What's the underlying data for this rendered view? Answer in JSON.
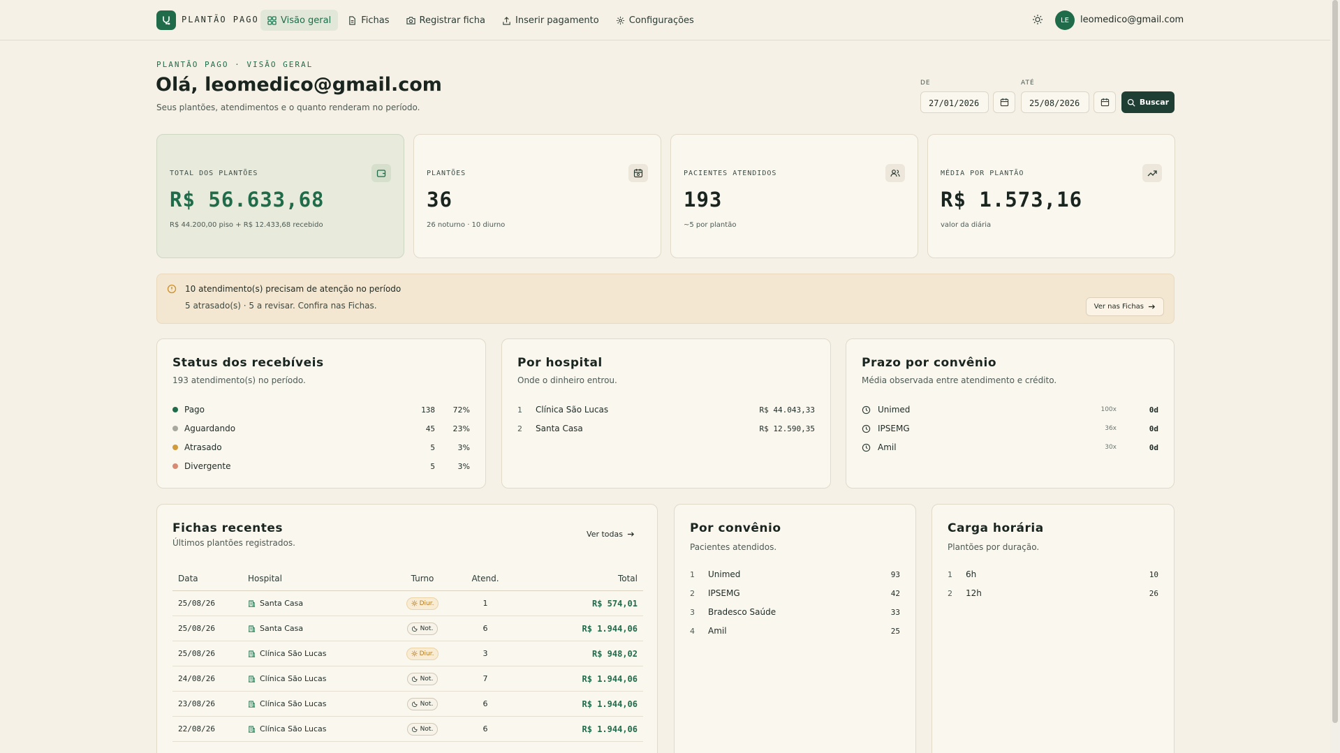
{
  "nav": {
    "brand": "PLANTÃO PAGO",
    "items": [
      {
        "label": "Visão geral",
        "icon": "grid-icon",
        "active": true
      },
      {
        "label": "Fichas",
        "icon": "file-icon"
      },
      {
        "label": "Registrar ficha",
        "icon": "camera-icon"
      },
      {
        "label": "Inserir pagamento",
        "icon": "upload-icon"
      },
      {
        "label": "Configurações",
        "icon": "gear-icon"
      }
    ],
    "avatar": "LE",
    "email": "leomedico@gmail.com"
  },
  "header": {
    "breadcrumb": "PLANTÃO PAGO · VISÃO GERAL",
    "greeting": "Olá, leomedico@gmail.com",
    "subtitle": "Seus plantões, atendimentos e o quanto renderam no período.",
    "from_label": "DE",
    "from_value": "27/01/2026",
    "to_label": "ATÉ",
    "to_value": "25/08/2026",
    "search_label": "Buscar"
  },
  "stats": [
    {
      "label": "TOTAL DOS PLANTÕES",
      "value": "R$ 56.633,68",
      "note": "R$ 44.200,00 piso + R$ 12.433,68 recebido",
      "icon": "wallet-icon"
    },
    {
      "label": "PLANTÕES",
      "value": "36",
      "note": "26 noturno · 10 diurno",
      "icon": "calendar-icon"
    },
    {
      "label": "PACIENTES ATENDIDOS",
      "value": "193",
      "note": "~5 por plantão",
      "icon": "users-icon"
    },
    {
      "label": "MÉDIA POR PLANTÃO",
      "value": "R$ 1.573,16",
      "note": "valor da diária",
      "icon": "trend-up-icon"
    }
  ],
  "alert": {
    "title": "10 atendimento(s) precisam de atenção no período",
    "detail": "5 atrasado(s) · 5 a revisar. Confira nas Fichas.",
    "button": "Ver nas Fichas"
  },
  "status": {
    "title": "Status dos recebíveis",
    "subtitle": "193 atendimento(s) no período.",
    "items": [
      {
        "label": "Pago",
        "count": "138",
        "pct": "72%",
        "color": "#1f6b4a"
      },
      {
        "label": "Aguardando",
        "count": "45",
        "pct": "23%",
        "color": "#a8a89f"
      },
      {
        "label": "Atrasado",
        "count": "5",
        "pct": "3%",
        "color": "#d19a3a"
      },
      {
        "label": "Divergente",
        "count": "5",
        "pct": "3%",
        "color": "#d88b72"
      }
    ]
  },
  "hospital": {
    "title": "Por hospital",
    "subtitle": "Onde o dinheiro entrou.",
    "items": [
      {
        "rank": "1",
        "name": "Clínica São Lucas",
        "amount": "R$ 44.043,33"
      },
      {
        "rank": "2",
        "name": "Santa Casa",
        "amount": "R$ 12.590,35"
      }
    ]
  },
  "prazo": {
    "title": "Prazo por convênio",
    "subtitle": "Média observada entre atendimento e crédito.",
    "items": [
      {
        "name": "Unimed",
        "count": "100x",
        "days": "0d"
      },
      {
        "name": "IPSEMG",
        "count": "36x",
        "days": "0d"
      },
      {
        "name": "Amil",
        "count": "30x",
        "days": "0d"
      }
    ]
  },
  "fichas": {
    "title": "Fichas recentes",
    "subtitle": "Últimos plantões registrados.",
    "see_all": "Ver todas",
    "columns": [
      "Data",
      "Hospital",
      "Turno",
      "Atend.",
      "Total"
    ],
    "rows": [
      {
        "date": "25/08/26",
        "hospital": "Santa Casa",
        "shift": "Diur.",
        "shift_type": "day",
        "count": "1",
        "total": "R$ 574,01"
      },
      {
        "date": "25/08/26",
        "hospital": "Santa Casa",
        "shift": "Not.",
        "shift_type": "night",
        "count": "6",
        "total": "R$ 1.944,06"
      },
      {
        "date": "25/08/26",
        "hospital": "Clínica São Lucas",
        "shift": "Diur.",
        "shift_type": "day",
        "count": "3",
        "total": "R$ 948,02"
      },
      {
        "date": "24/08/26",
        "hospital": "Clínica São Lucas",
        "shift": "Not.",
        "shift_type": "night",
        "count": "7",
        "total": "R$ 1.944,06"
      },
      {
        "date": "23/08/26",
        "hospital": "Clínica São Lucas",
        "shift": "Not.",
        "shift_type": "night",
        "count": "6",
        "total": "R$ 1.944,06"
      },
      {
        "date": "22/08/26",
        "hospital": "Clínica São Lucas",
        "shift": "Not.",
        "shift_type": "night",
        "count": "6",
        "total": "R$ 1.944,06"
      }
    ]
  },
  "convenio": {
    "title": "Por convênio",
    "subtitle": "Pacientes atendidos.",
    "items": [
      {
        "rank": "1",
        "name": "Unimed",
        "count": "93"
      },
      {
        "rank": "2",
        "name": "IPSEMG",
        "count": "42"
      },
      {
        "rank": "3",
        "name": "Bradesco Saúde",
        "count": "33"
      },
      {
        "rank": "4",
        "name": "Amil",
        "count": "25"
      }
    ]
  },
  "carga": {
    "title": "Carga horária",
    "subtitle": "Plantões por duração.",
    "items": [
      {
        "rank": "1",
        "name": "6h",
        "count": "10"
      },
      {
        "rank": "2",
        "name": "12h",
        "count": "26"
      }
    ]
  }
}
